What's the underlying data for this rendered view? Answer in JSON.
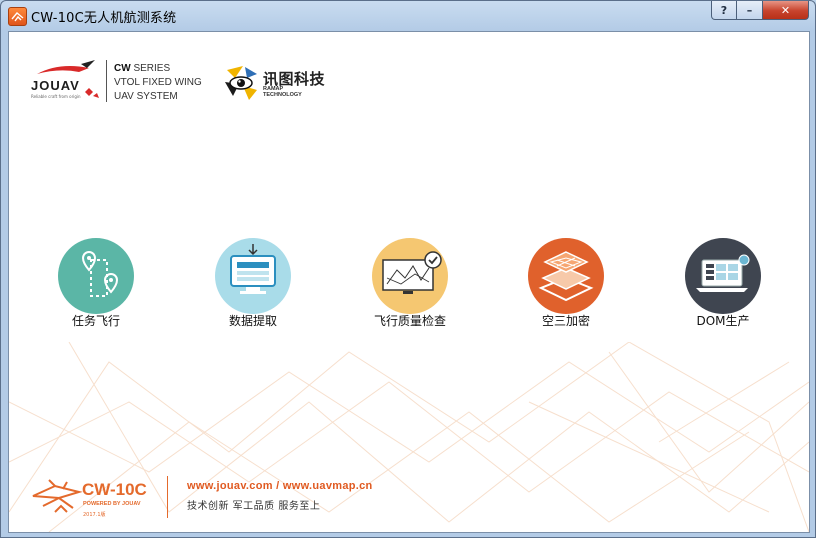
{
  "window": {
    "title": "CW-10C无人机航测系统",
    "buttons": {
      "help": "?",
      "minimize": "–",
      "close": "✕"
    }
  },
  "header": {
    "jouav": {
      "brand": "JOUAV",
      "slogan": "Reliable craft from origin"
    },
    "cw_series": {
      "line1_bold": "CW",
      "line1_rest": " SERIES",
      "line2": "VTOL FIXED WING",
      "line3": "UAV SYSTEM"
    },
    "ramap": {
      "cn": "讯图科技",
      "en1": "RAMAP",
      "en2": "TECHNOLOGY"
    }
  },
  "modules": [
    {
      "label": "任务飞行",
      "color": "#5bb6a6",
      "icon": "route-pin-icon"
    },
    {
      "label": "数据提取",
      "color": "#a9dce9",
      "icon": "monitor-download-icon"
    },
    {
      "label": "飞行质量检查",
      "color": "#f5c771",
      "icon": "quality-check-icon"
    },
    {
      "label": "空三加密",
      "color": "#e0612c",
      "icon": "aerial-triangulation-icon"
    },
    {
      "label": "DOM生产",
      "color": "#3f4550",
      "icon": "laptop-dom-icon"
    }
  ],
  "footer": {
    "product": "CW-10C",
    "powered": "POWERED BY JOUAV",
    "version": "2017.1版",
    "urls": "www.jouav.com / www.uavmap.cn",
    "slogan": "技术创新  军工品质  服务至上",
    "accent": "#e46a2c"
  }
}
